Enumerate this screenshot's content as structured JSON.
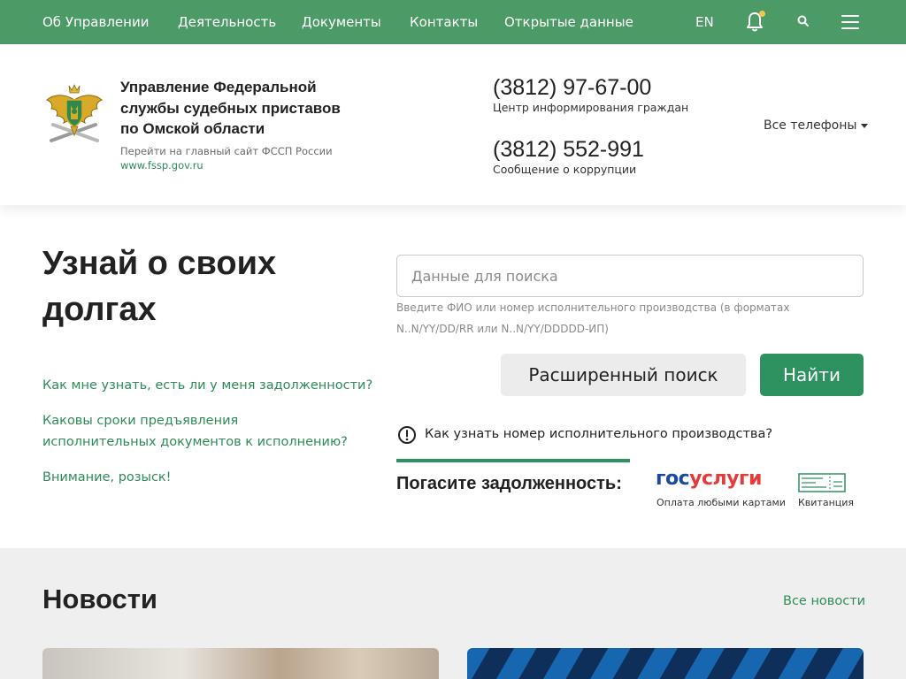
{
  "topnav": {
    "items": [
      "Об Управлении",
      "Деятельность",
      "Документы",
      "Контакты",
      "Открытые данные"
    ],
    "lang": "EN",
    "accent_color": "#4c9a66"
  },
  "header": {
    "org_title": "Управление Федеральной службы судебных приставов по Омской области",
    "main_site_note": "Перейти на главный сайт ФССП России",
    "main_site_link": "www.fssp.gov.ru",
    "phones": [
      {
        "number": "(3812) 97-67-00",
        "note": "Центр информирования граждан"
      },
      {
        "number": "(3812) 552-991",
        "note": "Сообщение о коррупции"
      }
    ],
    "all_phones": "Все телефоны"
  },
  "debt": {
    "title": "Узнай о своих долгах",
    "faq": [
      "Как мне узнать, есть ли у меня задолженности?",
      "Каковы сроки предъявления исполнительных документов к исполнению?",
      "Внимание, розыск!"
    ],
    "search_placeholder": "Данные для поиска",
    "search_value": "",
    "search_hint": "Введите ФИО или номер исполнительного производства (в форматах N..N/YY/DD/RR или N..N/YY/DDDDD-ИП)",
    "advanced_label": "Расширенный поиск",
    "find_label": "Найти",
    "info_link": "Как узнать номер исполнительного производства?",
    "pay_title": "Погасите задолженность:",
    "gos_logo_blue": "гос",
    "gos_logo_red": "услуги",
    "gos_caption": "Оплата любыми картами",
    "receipt_caption": "Квитанция",
    "primary_color": "#2e9160"
  },
  "news": {
    "title": "Новости",
    "all_label": "Все новости"
  }
}
